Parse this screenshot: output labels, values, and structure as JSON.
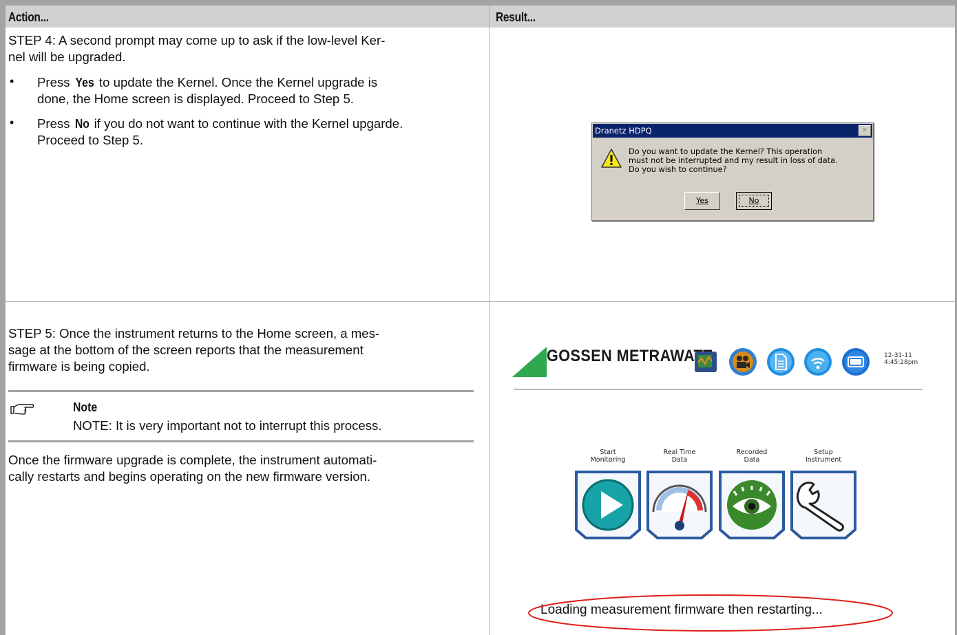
{
  "table": {
    "header": {
      "action": "Action...",
      "result": "Result..."
    }
  },
  "step4": {
    "intro_line1": "STEP 4: A second prompt may come up to ask if the low-level Ker-",
    "intro_line2": "nel will be upgraded.",
    "bullet1": {
      "bold": "Yes",
      "line1_pre": "Press ",
      "line1_post": " to update the Kernel. Once the Kernel upgrade is",
      "line2": "done, the Home screen is displayed. Proceed to Step 5."
    },
    "bullet2": {
      "bold": "No",
      "line1_pre": "Press ",
      "line1_post": " if you do not want to continue with the Kernel upgarde.",
      "line2": "Proceed to Step 5."
    },
    "bullet_glyph": "•"
  },
  "dialog": {
    "title": "Dranetz HDPQ",
    "close_glyph": "×",
    "icon": "warning-icon",
    "message_line1": "Do you want to update the Kernel? This operation",
    "message_line2": "must not be interrupted and my result in loss of data.",
    "message_line3": "Do you wish to continue?",
    "yes_label": "Yes",
    "no_label": "No"
  },
  "step5": {
    "line1": "STEP 5: Once the instrument returns to the Home screen, a mes-",
    "line2": "sage at the bottom of the screen reports that the measurement",
    "line3": "firmware is being copied.",
    "note_title": "Note",
    "note_text": "NOTE: It is very important not to interrupt this process.",
    "after_line1": "Once the firmware upgrade is complete, the instrument automati-",
    "after_line2": "cally restarts and begins operating on the new firmware version."
  },
  "home_screen": {
    "brand": "GOSSEN METRAWATT",
    "date": "12-31-11",
    "time": "4:45:28pm",
    "top_icons": [
      "scope-icon",
      "camera-icon",
      "document-icon",
      "wifi-icon",
      "battery-icon"
    ],
    "tiles": [
      {
        "label_line1": "Start",
        "label_line2": "Monitoring",
        "icon": "play-icon"
      },
      {
        "label_line1": "Real Time",
        "label_line2": "Data",
        "icon": "gauge-icon"
      },
      {
        "label_line1": "Recorded",
        "label_line2": "Data",
        "icon": "eye-icon"
      },
      {
        "label_line1": "Setup",
        "label_line2": "Instrument",
        "icon": "wrench-icon"
      }
    ],
    "status_message": "Loading measurement firmware then restarting..."
  },
  "colors": {
    "frame": "#a3a3a3",
    "header_bg": "#d1d1d1",
    "dialog_title": "#0a246a",
    "brand_green": "#2fa84f",
    "highlight_ellipse": "#e0201a",
    "tile_blue": "#2c5aa0"
  }
}
